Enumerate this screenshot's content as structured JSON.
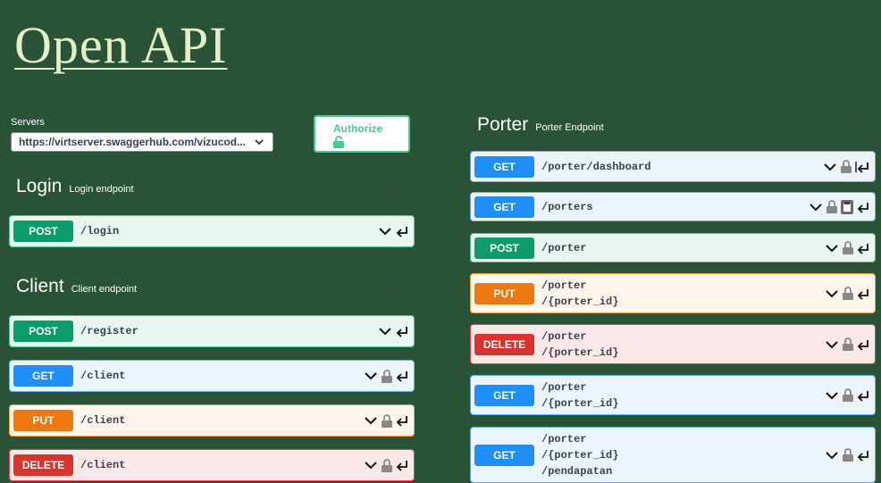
{
  "title": "Open API",
  "servers": {
    "label": "Servers",
    "selected": "https://virtserver.swaggerhub.com/vizucod..."
  },
  "authorize": {
    "label": "Authorize"
  },
  "sections": {
    "login": {
      "name": "Login",
      "desc": "Login endpoint"
    },
    "client": {
      "name": "Client",
      "desc": "Client endpoint"
    },
    "porter": {
      "name": "Porter",
      "desc": "Porter Endpoint"
    }
  },
  "ops": {
    "login_post": {
      "method": "POST",
      "path": [
        "/login"
      ]
    },
    "client_register": {
      "method": "POST",
      "path": [
        "/register"
      ]
    },
    "client_get": {
      "method": "GET",
      "path": [
        "/client"
      ]
    },
    "client_put": {
      "method": "PUT",
      "path": [
        "/client"
      ]
    },
    "client_delete": {
      "method": "DELETE",
      "path": [
        "/client"
      ]
    },
    "porter_dashboard": {
      "method": "GET",
      "path": [
        "/porter/dashboard"
      ]
    },
    "porters_get": {
      "method": "GET",
      "path": [
        "/porters"
      ]
    },
    "porter_post": {
      "method": "POST",
      "path": [
        "/porter"
      ]
    },
    "porter_put": {
      "method": "PUT",
      "path": [
        "/porter",
        "/{porter_id}"
      ]
    },
    "porter_delete": {
      "method": "DELETE",
      "path": [
        "/porter",
        "/{porter_id}"
      ]
    },
    "porter_get_id": {
      "method": "GET",
      "path": [
        "/porter",
        "/{porter_id}"
      ]
    },
    "porter_pendapatan": {
      "method": "GET",
      "path": [
        "/porter",
        "/{porter_id}",
        "/pendapatan"
      ]
    }
  },
  "colors": {
    "background": "#2a5236",
    "get": "#1f8ef6",
    "post": "#0e9a69",
    "put": "#ec7812",
    "delete": "#d8332f",
    "title": "#e3f0c6"
  }
}
